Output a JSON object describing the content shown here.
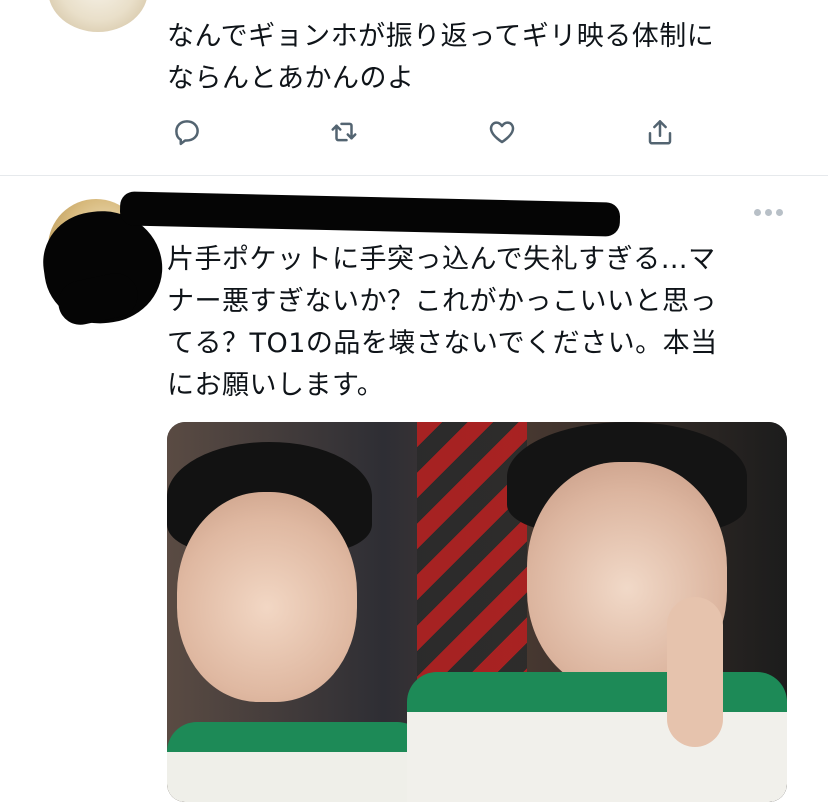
{
  "tweets": [
    {
      "text_lines": [
        "なんでギョンホが振り返ってギリ映る体制に",
        "ならんとあかんのよ"
      ],
      "actions": [
        {
          "name": "reply-icon"
        },
        {
          "name": "retweet-icon"
        },
        {
          "name": "like-icon"
        },
        {
          "name": "share-icon"
        }
      ]
    },
    {
      "text_lines": [
        "片手ポケットに手突っ込んで失礼すぎる…マ",
        "ナー悪すぎないか？これがかっこいいと思っ",
        "てる？TO1の品を壊さないでください。本当",
        "にお願いします。"
      ],
      "more_icon": "more-horizontal-icon",
      "media": "photo-two-people"
    }
  ],
  "colors": {
    "text": "#0f1419",
    "icon": "#536471",
    "divider": "#e6e9ec",
    "accent_green": "#1d8a57"
  }
}
